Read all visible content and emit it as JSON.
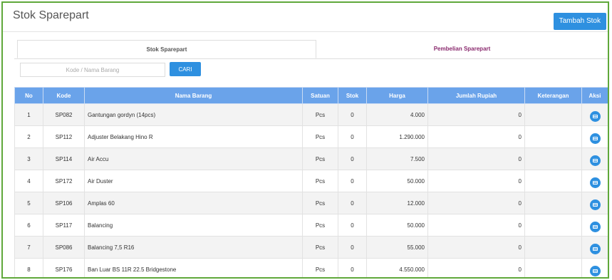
{
  "header": {
    "title": "Stok Sparepart",
    "add_button_label": "Tambah Stok"
  },
  "tabs": [
    {
      "label": "Stok Sparepart"
    },
    {
      "label": "Pembelian Sparepart"
    }
  ],
  "search": {
    "placeholder": "Kode / Nama Barang",
    "value": "",
    "button_label": "CARI"
  },
  "colors": {
    "accent": "#2e90e0",
    "table_header": "#6aa3ea",
    "frame_border": "#5fa83a",
    "inactive_tab": "#8a2a6e"
  },
  "table": {
    "columns": [
      "No",
      "Kode",
      "Nama Barang",
      "Satuan",
      "Stok",
      "Harga",
      "Jumlah Rupiah",
      "Keterangan",
      "Aksi"
    ],
    "action_icon": "edit-icon",
    "rows": [
      {
        "no": "1",
        "kode": "SP082",
        "nama": "Gantungan gordyn (14pcs)",
        "satuan": "Pcs",
        "stok": "0",
        "harga": "4.000",
        "jumlah": "0",
        "keterangan": ""
      },
      {
        "no": "2",
        "kode": "SP112",
        "nama": "Adjuster Belakang Hino R",
        "satuan": "Pcs",
        "stok": "0",
        "harga": "1.290.000",
        "jumlah": "0",
        "keterangan": ""
      },
      {
        "no": "3",
        "kode": "SP114",
        "nama": "Air Accu",
        "satuan": "Pcs",
        "stok": "0",
        "harga": "7.500",
        "jumlah": "0",
        "keterangan": ""
      },
      {
        "no": "4",
        "kode": "SP172",
        "nama": "Air Duster",
        "satuan": "Pcs",
        "stok": "0",
        "harga": "50.000",
        "jumlah": "0",
        "keterangan": ""
      },
      {
        "no": "5",
        "kode": "SP106",
        "nama": "Amplas 60",
        "satuan": "Pcs",
        "stok": "0",
        "harga": "12.000",
        "jumlah": "0",
        "keterangan": ""
      },
      {
        "no": "6",
        "kode": "SP117",
        "nama": "Balancing",
        "satuan": "Pcs",
        "stok": "0",
        "harga": "50.000",
        "jumlah": "0",
        "keterangan": ""
      },
      {
        "no": "7",
        "kode": "SP086",
        "nama": "Balancing 7,5 R16",
        "satuan": "Pcs",
        "stok": "0",
        "harga": "55.000",
        "jumlah": "0",
        "keterangan": ""
      },
      {
        "no": "8",
        "kode": "SP176",
        "nama": "Ban Luar BS 11R 22.5 Bridgestone",
        "satuan": "Pcs",
        "stok": "0",
        "harga": "4.550.000",
        "jumlah": "0",
        "keterangan": ""
      }
    ]
  }
}
